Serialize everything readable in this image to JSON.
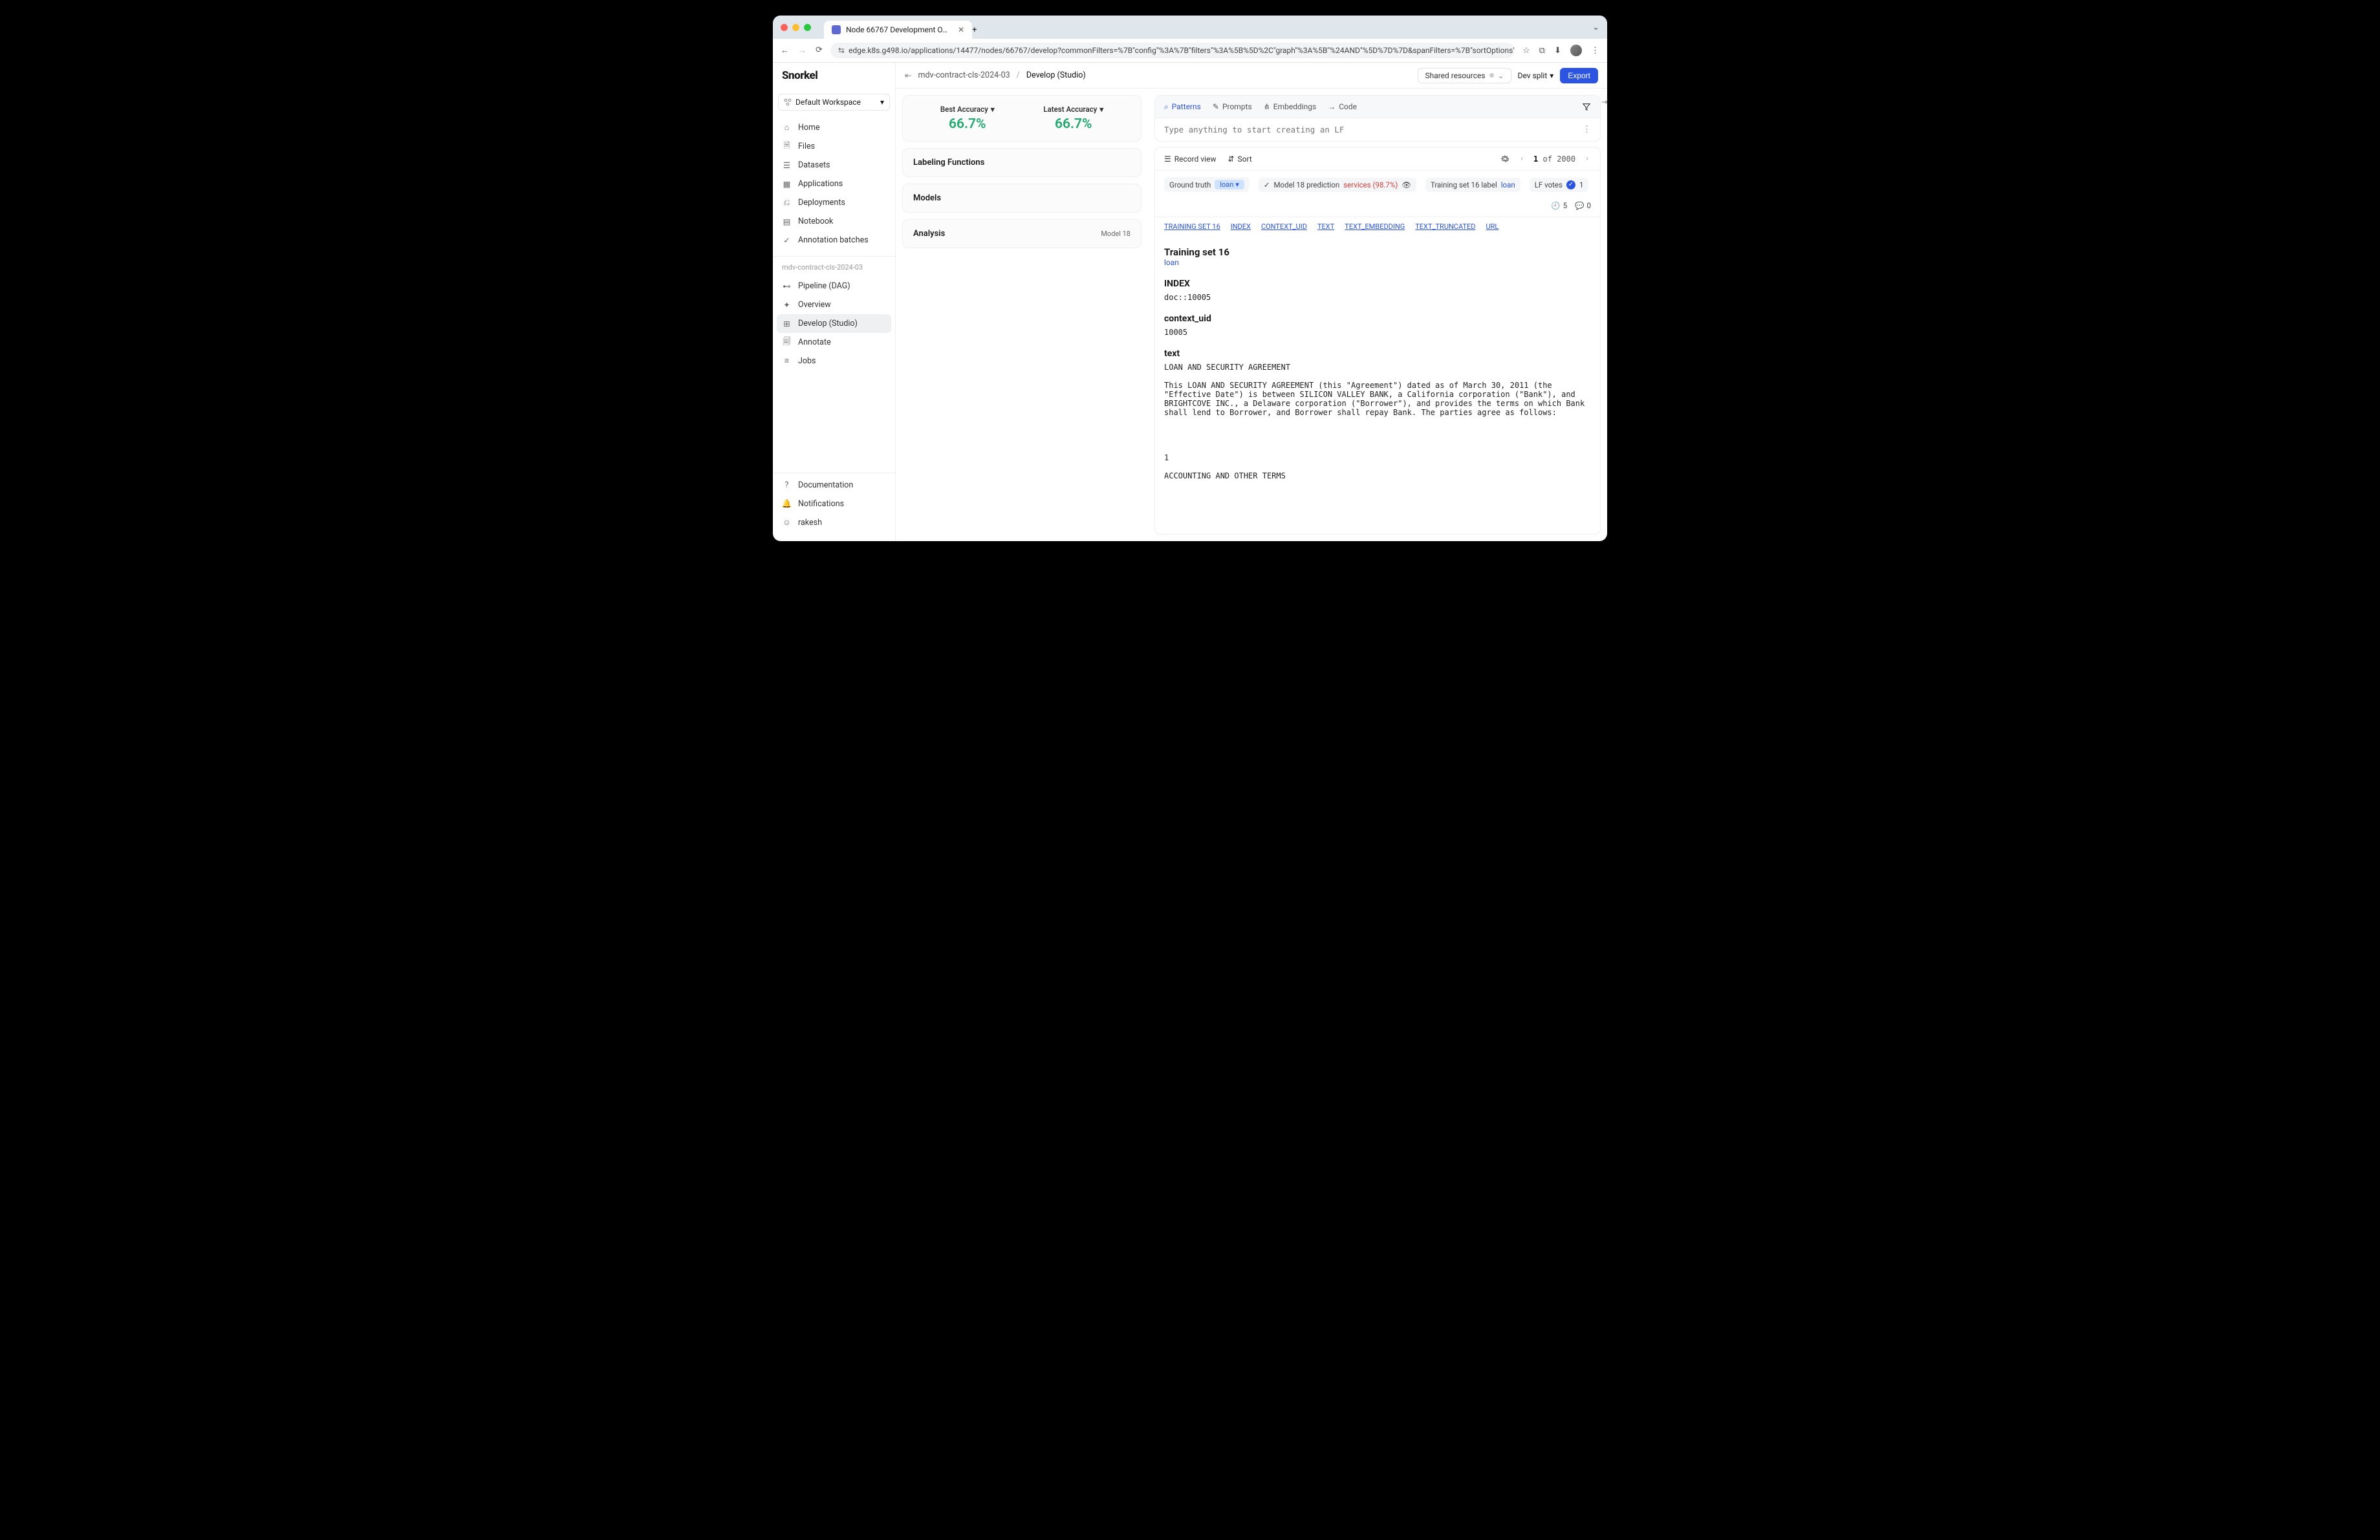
{
  "browser": {
    "tab_title": "Node 66767 Development O…",
    "url_display": "edge.k8s.g498.io/applications/14477/nodes/66767/develop?commonFilters=%7B\"config\"%3A%7B\"filters\"%3A%5B%5D%2C\"graph\"%3A%5B\"%24AND\"%5D%7D%7D&spanFilters=%7B\"sortOptions\"%…"
  },
  "logo_text": "Snorkel",
  "workspace": {
    "label": "Default Workspace"
  },
  "nav_main": [
    {
      "label": "Home"
    },
    {
      "label": "Files"
    },
    {
      "label": "Datasets"
    },
    {
      "label": "Applications"
    },
    {
      "label": "Deployments"
    },
    {
      "label": "Notebook"
    },
    {
      "label": "Annotation batches"
    }
  ],
  "nav_section_label": "mdv-contract-cls-2024-03",
  "nav_app": [
    {
      "label": "Pipeline (DAG)"
    },
    {
      "label": "Overview"
    },
    {
      "label": "Develop (Studio)",
      "active": true
    },
    {
      "label": "Annotate"
    },
    {
      "label": "Jobs"
    }
  ],
  "nav_bottom": [
    {
      "label": "Documentation"
    },
    {
      "label": "Notifications"
    },
    {
      "label": "rakesh"
    }
  ],
  "breadcrumb": {
    "root": "mdv-contract-cls-2024-03",
    "current": "Develop (Studio)"
  },
  "top_right": {
    "shared": "Shared resources",
    "split": "Dev split",
    "export": "Export"
  },
  "metrics": {
    "best_label": "Best Accuracy",
    "best_value": "66.7%",
    "latest_label": "Latest Accuracy",
    "latest_value": "66.7%"
  },
  "sections": {
    "lf": "Labeling Functions",
    "models": "Models",
    "analysis": "Analysis",
    "analysis_model": "Model 18"
  },
  "tabs": {
    "patterns": "Patterns",
    "prompts": "Prompts",
    "embeddings": "Embeddings",
    "code": "Code"
  },
  "lf_placeholder": "Type anything to start creating an LF",
  "rec_head": {
    "record_view": "Record view",
    "sort": "Sort",
    "page_cur": "1",
    "page_of": "of",
    "page_total": "2000"
  },
  "meta": {
    "ground_truth": "Ground truth",
    "gt_value": "loan",
    "pred_label": "Model 18 prediction",
    "pred_value": "services (98.7%)",
    "ts_label": "Training set 16 label",
    "ts_value": "loan",
    "lf_votes": "LF votes",
    "lf_votes_count": "1",
    "clock": "5",
    "comments": "0"
  },
  "anchors": [
    "TRAINING SET 16",
    "INDEX",
    "CONTEXT_UID",
    "TEXT",
    "TEXT_EMBEDDING",
    "TEXT_TRUNCATED",
    "URL"
  ],
  "record": {
    "title": "Training set 16",
    "title_value": "loan",
    "index_h": "INDEX",
    "index_v": "doc::10005",
    "ctx_h": "context_uid",
    "ctx_v": "10005",
    "text_h": "text",
    "text_body": "LOAN AND SECURITY AGREEMENT\n\nThis LOAN AND SECURITY AGREEMENT (this \"Agreement\") dated as of March 30, 2011 (the \"Effective Date\") is between SILICON VALLEY BANK, a California corporation (\"Bank\"), and BRIGHTCOVE INC., a Delaware corporation (\"Borrower\"), and provides the terms on which Bank shall lend to Borrower, and Borrower shall repay Bank. The parties agree as follows:\n\n\n\n\n1\n\nACCOUNTING AND OTHER TERMS"
  }
}
